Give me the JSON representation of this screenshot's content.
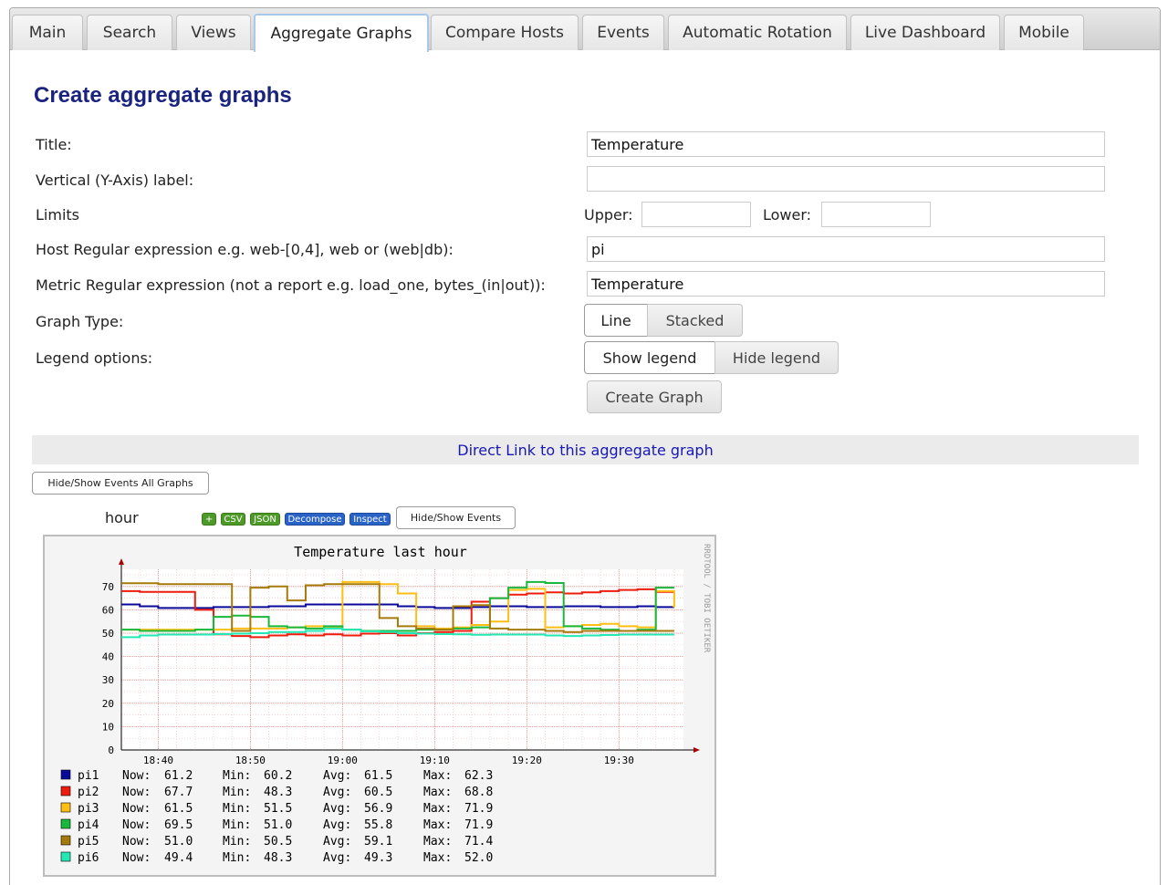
{
  "tabs": [
    "Main",
    "Search",
    "Views",
    "Aggregate Graphs",
    "Compare Hosts",
    "Events",
    "Automatic Rotation",
    "Live Dashboard",
    "Mobile"
  ],
  "active_tab": "Aggregate Graphs",
  "form": {
    "heading": "Create aggregate graphs",
    "title_label": "Title:",
    "title_value": "Temperature",
    "ylabel_label": "Vertical (Y-Axis) label:",
    "ylabel_value": "",
    "limits_label": "Limits",
    "upper_label": "Upper:",
    "lower_label": "Lower:",
    "upper_value": "",
    "lower_value": "",
    "host_label": "Host Regular expression e.g. web-[0,4], web or (web|db):",
    "host_value": "pi",
    "metric_label": "Metric Regular expression (not a report e.g. load_one, bytes_(in|out)):",
    "metric_value": "Temperature",
    "graph_type_label": "Graph Type:",
    "graph_type_options": [
      "Line",
      "Stacked"
    ],
    "graph_type_selected": "Line",
    "legend_label": "Legend options:",
    "legend_options": [
      "Show legend",
      "Hide legend"
    ],
    "legend_selected": "Show legend",
    "create_button": "Create Graph"
  },
  "direct_link": "Direct Link to this aggregate graph",
  "hide_show_all": "Hide/Show Events All Graphs",
  "graph_panel": {
    "range": "hour",
    "badges": [
      "+",
      "CSV",
      "JSON",
      "Decompose",
      "Inspect"
    ],
    "hide_show": "Hide/Show Events",
    "watermark": "RRDTOOL / TOBI OETIKER"
  },
  "colors": {
    "pi1": "#0a0a9a",
    "pi2": "#ee1c0c",
    "pi3": "#ffbe14",
    "pi4": "#18b83c",
    "pi5": "#a67a0a",
    "pi6": "#22e8b4"
  },
  "chart_data": {
    "type": "line",
    "title": "Temperature last hour",
    "xlabel": "",
    "ylabel": "",
    "ylim": [
      0,
      75
    ],
    "y_ticks": [
      0,
      10,
      20,
      30,
      40,
      50,
      60,
      70
    ],
    "x_range": [
      "18:36",
      "19:37"
    ],
    "x_ticks": [
      "18:40",
      "18:50",
      "19:00",
      "19:10",
      "19:20",
      "19:30"
    ],
    "grid": true,
    "legend_placement": "bottom",
    "legend_headers": [
      "Now:",
      "Min:",
      "Avg:",
      "Max:"
    ],
    "x": [
      "18:36",
      "18:38",
      "18:40",
      "18:42",
      "18:44",
      "18:46",
      "18:48",
      "18:50",
      "18:52",
      "18:54",
      "18:56",
      "18:58",
      "19:00",
      "19:02",
      "19:04",
      "19:06",
      "19:08",
      "19:10",
      "19:12",
      "19:14",
      "19:16",
      "19:18",
      "19:20",
      "19:22",
      "19:24",
      "19:26",
      "19:28",
      "19:30",
      "19:32",
      "19:34",
      "19:36"
    ],
    "series": [
      {
        "name": "pi1",
        "now": "61.2",
        "min": "60.2",
        "avg": "61.5",
        "max": "62.3",
        "values": [
          62.3,
          61.5,
          60.8,
          60.8,
          60.8,
          61.2,
          61.2,
          61.2,
          61.5,
          61.5,
          62.3,
          62.3,
          62.3,
          62.3,
          62.3,
          61.5,
          61.2,
          60.8,
          60.8,
          61.2,
          61.5,
          61.5,
          61.2,
          61.2,
          61.5,
          61.5,
          61.2,
          61.2,
          61.5,
          61.2,
          61.2
        ]
      },
      {
        "name": "pi2",
        "now": "67.7",
        "min": "48.3",
        "avg": "60.5",
        "max": "68.8",
        "values": [
          68.0,
          67.7,
          67.7,
          67.7,
          60.0,
          49.5,
          48.8,
          48.3,
          49.0,
          49.5,
          49.0,
          49.5,
          49.0,
          49.8,
          50.0,
          49.0,
          50.0,
          50.5,
          51.0,
          63.5,
          65.0,
          66.5,
          67.0,
          67.5,
          67.0,
          67.5,
          68.0,
          68.5,
          68.8,
          67.7,
          67.7
        ]
      },
      {
        "name": "pi3",
        "now": "61.5",
        "min": "51.5",
        "avg": "56.9",
        "max": "71.9",
        "values": [
          51.5,
          51.5,
          51.5,
          51.5,
          51.5,
          51.5,
          52.0,
          52.0,
          52.0,
          52.5,
          53.0,
          52.5,
          71.9,
          71.9,
          71.0,
          67.0,
          53.0,
          52.0,
          52.5,
          53.5,
          55.0,
          68.5,
          69.0,
          52.5,
          53.0,
          53.5,
          54.0,
          53.0,
          52.5,
          68.0,
          61.5
        ]
      },
      {
        "name": "pi4",
        "now": "69.5",
        "min": "51.0",
        "avg": "55.8",
        "max": "71.9",
        "values": [
          51.5,
          51.0,
          51.0,
          51.0,
          51.5,
          57.0,
          57.5,
          57.0,
          53.0,
          52.5,
          52.0,
          53.0,
          51.5,
          51.0,
          51.0,
          51.0,
          51.5,
          51.5,
          52.0,
          52.5,
          65.0,
          69.5,
          71.9,
          71.5,
          53.0,
          52.0,
          51.5,
          51.0,
          51.5,
          69.5,
          69.5
        ]
      },
      {
        "name": "pi5",
        "now": "51.0",
        "min": "50.5",
        "avg": "59.1",
        "max": "71.4",
        "values": [
          71.4,
          71.4,
          71.0,
          71.0,
          71.0,
          71.0,
          51.0,
          69.5,
          70.0,
          64.0,
          70.5,
          71.0,
          71.0,
          71.0,
          56.5,
          53.0,
          52.0,
          51.5,
          61.5,
          62.0,
          52.0,
          51.5,
          51.5,
          51.0,
          50.5,
          51.0,
          51.0,
          51.0,
          51.0,
          51.0,
          51.0
        ]
      },
      {
        "name": "pi6",
        "now": "49.4",
        "min": "48.3",
        "avg": "49.3",
        "max": "52.0",
        "values": [
          48.3,
          49.0,
          49.4,
          49.4,
          49.4,
          49.6,
          49.8,
          50.0,
          50.5,
          50.5,
          51.0,
          52.0,
          51.5,
          50.8,
          50.5,
          50.0,
          49.8,
          49.6,
          49.5,
          49.3,
          49.4,
          49.4,
          49.4,
          49.0,
          48.8,
          49.0,
          49.2,
          49.4,
          49.4,
          49.4,
          49.4
        ]
      }
    ]
  }
}
